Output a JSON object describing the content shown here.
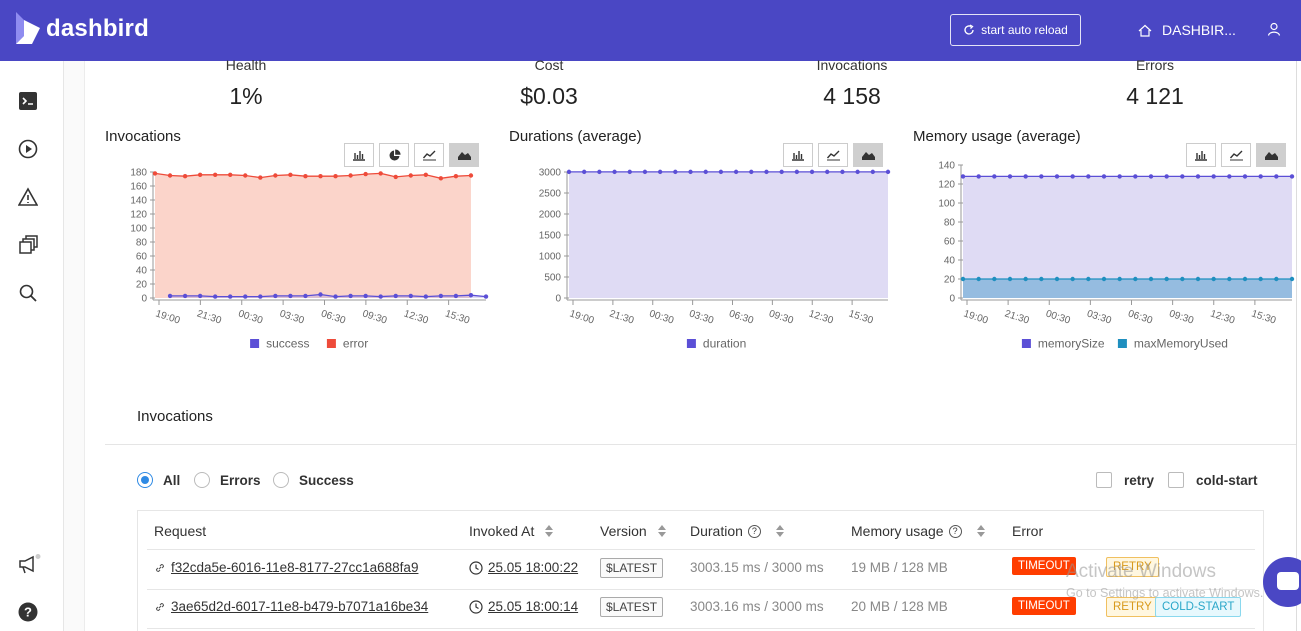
{
  "brand": {
    "name": "dashbird",
    "color": "#4a47c4"
  },
  "topbar": {
    "reload_label": "start auto reload",
    "reload_icon": "refresh-icon",
    "account_label": "DASHBIR...",
    "home_icon": "home-icon",
    "user_icon": "user-icon"
  },
  "sidebar": {
    "items": [
      {
        "icon": "terminal-icon"
      },
      {
        "icon": "play-icon"
      },
      {
        "icon": "warning-icon"
      },
      {
        "icon": "stack-icon"
      },
      {
        "icon": "search-icon"
      }
    ],
    "bottom": [
      {
        "icon": "megaphone-icon"
      },
      {
        "icon": "help-icon"
      }
    ]
  },
  "stats": [
    {
      "label": "Health",
      "value": "1%"
    },
    {
      "label": "Cost",
      "value": "$0.03"
    },
    {
      "label": "Invocations",
      "value": "4 158"
    },
    {
      "label": "Errors",
      "value": "4 121"
    }
  ],
  "charts_section": {
    "toolbar_icons": [
      "bar-chart-icon",
      "pie-chart-icon",
      "line-chart-icon",
      "area-chart-icon"
    ],
    "x_ticks": [
      "19:00",
      "21:30",
      "00:30",
      "03:30",
      "06:30",
      "09:30",
      "12:30",
      "15:30"
    ]
  },
  "chart_data": [
    {
      "type": "area",
      "title": "Invocations",
      "ylim": [
        0,
        180
      ],
      "yticks": [
        "180",
        "160",
        "140",
        "120",
        "100",
        "80",
        "60",
        "40",
        "20",
        "0"
      ],
      "x": [
        "19:00",
        "21:30",
        "00:30",
        "03:30",
        "06:30",
        "09:30",
        "12:30",
        "15:30"
      ],
      "series": [
        {
          "name": "success",
          "color": "#5b4fd6",
          "values": [
            null,
            3,
            3,
            3,
            2,
            2,
            2,
            2,
            3,
            3,
            3,
            5,
            2,
            3,
            3,
            2,
            3,
            3,
            2,
            3,
            3,
            4,
            2
          ]
        },
        {
          "name": "error",
          "color": "#ee4b3a",
          "values": [
            178,
            175,
            174,
            176,
            176,
            176,
            175,
            172,
            175,
            176,
            174,
            174,
            174,
            175,
            177,
            178,
            173,
            175,
            176,
            171,
            174,
            175
          ]
        }
      ],
      "legend": "bottom"
    },
    {
      "type": "area",
      "title": "Durations (average)",
      "ylim": [
        0,
        3000
      ],
      "yticks": [
        "3000",
        "2500",
        "2000",
        "1500",
        "1000",
        "500",
        "0"
      ],
      "x": [
        "19:00",
        "21:30",
        "00:30",
        "03:30",
        "06:30",
        "09:30",
        "12:30",
        "15:30"
      ],
      "series": [
        {
          "name": "duration",
          "color": "#5b4fd6",
          "values": [
            3003,
            3003,
            3003,
            3003,
            3003,
            3003,
            3003,
            3003,
            3003,
            3003,
            3003,
            3003,
            3003,
            3003,
            3003,
            3003,
            3003,
            3003,
            3003,
            3003,
            3003,
            3003
          ]
        }
      ],
      "legend": "bottom"
    },
    {
      "type": "area",
      "title": "Memory usage (average)",
      "ylim": [
        0,
        140
      ],
      "yticks": [
        "140",
        "120",
        "100",
        "80",
        "60",
        "40",
        "20",
        "0"
      ],
      "x": [
        "19:00",
        "21:30",
        "00:30",
        "03:30",
        "06:30",
        "09:30",
        "12:30",
        "15:30"
      ],
      "series": [
        {
          "name": "memorySize",
          "color": "#5b4fd6",
          "values": [
            128,
            128,
            128,
            128,
            128,
            128,
            128,
            128,
            128,
            128,
            128,
            128,
            128,
            128,
            128,
            128,
            128,
            128,
            128,
            128,
            128,
            128
          ]
        },
        {
          "name": "maxMemoryUsed",
          "color": "#1f8fbf",
          "values": [
            20,
            20,
            20,
            20,
            20,
            20,
            20,
            20,
            20,
            20,
            20,
            20,
            20,
            20,
            20,
            20,
            20,
            20,
            20,
            20,
            20,
            20
          ]
        }
      ],
      "legend": "bottom"
    }
  ],
  "invocations": {
    "title": "Invocations",
    "filters": [
      {
        "label": "All",
        "selected": true
      },
      {
        "label": "Errors",
        "selected": false
      },
      {
        "label": "Success",
        "selected": false
      }
    ],
    "checkboxes": [
      {
        "label": "retry"
      },
      {
        "label": "cold-start"
      }
    ],
    "columns": [
      "Request",
      "Invoked At",
      "Version",
      "Duration",
      "Memory usage",
      "Error"
    ],
    "rows": [
      {
        "request": "f32cda5e-6016-11e8-8177-27cc1a688fa9",
        "invoked": "25.05 18:00:22",
        "version": "$LATEST",
        "duration": "3003.15 ms / 3000 ms",
        "memory": "19 MB / 128 MB",
        "tags": [
          "TIMEOUT",
          "RETRY"
        ]
      },
      {
        "request": "3ae65d2d-6017-11e8-b479-b7071a16be34",
        "invoked": "25.05 18:00:14",
        "version": "$LATEST",
        "duration": "3003.16 ms / 3000 ms",
        "memory": "20 MB / 128 MB",
        "tags": [
          "TIMEOUT",
          "RETRY",
          "COLD-START"
        ]
      }
    ]
  },
  "overlay": {
    "watermark_title": "Activate Windows",
    "watermark_sub": "Go to Settings to activate Windows."
  }
}
